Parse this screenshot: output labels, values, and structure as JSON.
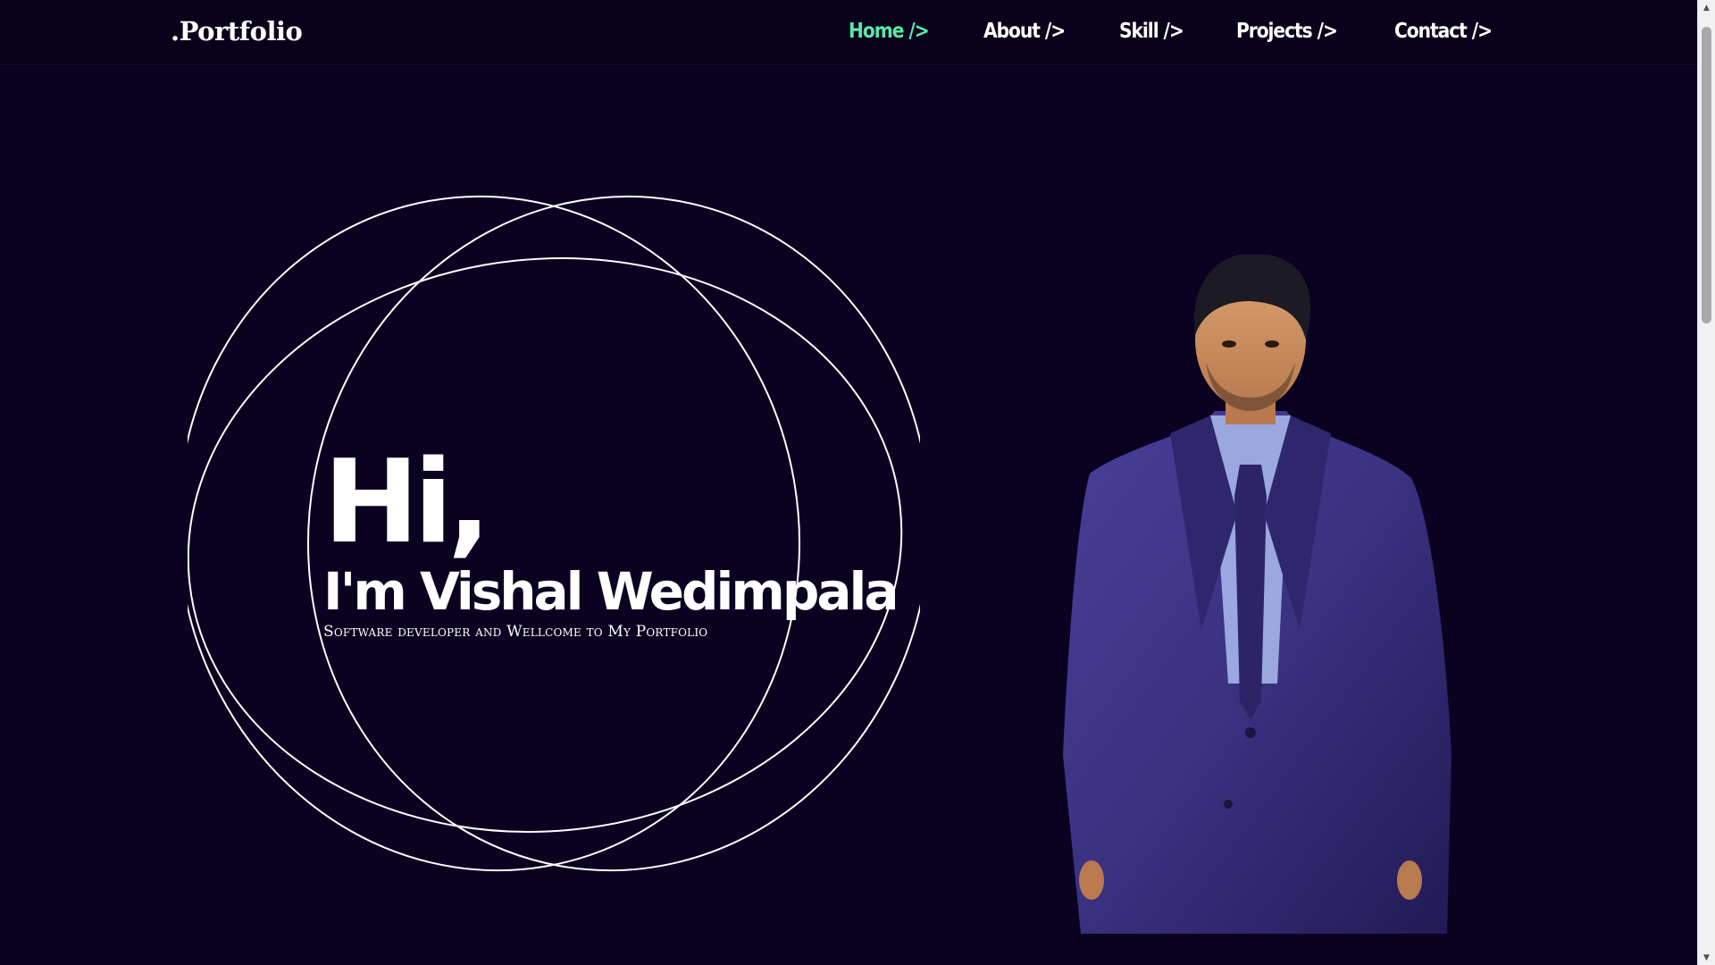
{
  "navbar": {
    "brand": ".Portfolio",
    "links": [
      {
        "label": "Home />",
        "active": true
      },
      {
        "label": "About />",
        "active": false
      },
      {
        "label": "Skill />",
        "active": false
      },
      {
        "label": "Projects />",
        "active": false
      },
      {
        "label": "Contact />",
        "active": false
      }
    ]
  },
  "hero": {
    "greeting": "Hi,",
    "name": "I'm Vishal Wedimpala",
    "tagline": "Software developer and Wellcome to My Portfolio"
  },
  "portrait": {
    "icon": "profile-photo"
  },
  "colors": {
    "background": "#0a0220",
    "navbar": "#09021a",
    "accent": "#5ee6a8",
    "text": "#ffffff"
  }
}
